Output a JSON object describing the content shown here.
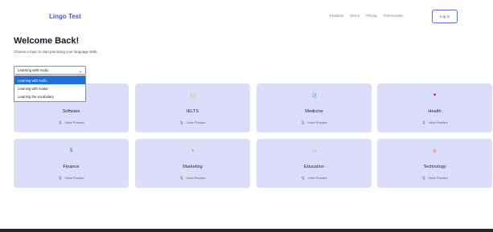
{
  "nav": {
    "brand": "Lingo Test",
    "links": [
      "Features",
      "Demo",
      "Pricing",
      "Testimonials"
    ],
    "login": "Log In"
  },
  "page": {
    "title": "Welcome Back!",
    "subtitle": "Choose a topic to start practicing your language skills"
  },
  "select": {
    "value": "Learning with Audio",
    "options": [
      "Learning with Audio",
      "Learning with Avatar",
      "Learning the vocabulary"
    ]
  },
  "cards": [
    {
      "name": "Software",
      "practice": "Voice Practice",
      "icon": "",
      "color": "#4a57d1"
    },
    {
      "name": "IELTS",
      "practice": "Voice Practice",
      "icon": "🗨",
      "color": "#e8a317"
    },
    {
      "name": "Medicine",
      "practice": "Voice Practice",
      "icon": "🩺",
      "color": "#e07a3f"
    },
    {
      "name": "Health",
      "practice": "Voice Practice",
      "icon": "♥",
      "color": "#c0182a"
    },
    {
      "name": "Finance",
      "practice": "Voice Practice",
      "icon": "$",
      "color": "#2e8b57"
    },
    {
      "name": "Marketing",
      "practice": "Voice Practice",
      "icon": "●",
      "color": "#f0a030"
    },
    {
      "name": "Education",
      "practice": "Voice Practice",
      "icon": "▭",
      "color": "#e07a3f"
    },
    {
      "name": "Technology",
      "practice": "Voice Practice",
      "icon": "⚙",
      "color": "#e88a30"
    }
  ],
  "mic_icon": "microphone-icon"
}
